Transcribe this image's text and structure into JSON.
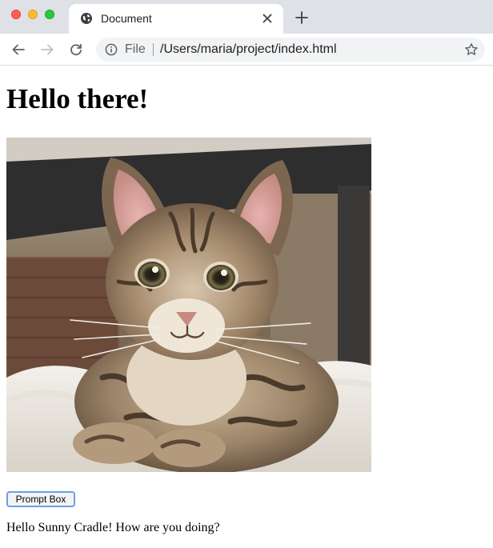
{
  "browser": {
    "tab": {
      "title": "Document"
    },
    "address": {
      "scheme": "File",
      "url": "/Users/maria/project/index.html"
    },
    "icons": {
      "tab_favicon": "globe-icon",
      "close": "close-icon",
      "new_tab": "plus-icon",
      "back": "arrow-left-icon",
      "forward": "arrow-right-icon",
      "reload": "reload-icon",
      "info": "info-icon",
      "bookmark": "star-icon"
    }
  },
  "page": {
    "heading": "Hello there!",
    "image": {
      "subject": "tabby kitten sitting on a fluffy white cat bed"
    },
    "button_label": "Prompt Box",
    "greeting": "Hello Sunny Cradle! How are you doing?"
  },
  "colors": {
    "tabbar_bg": "#dee1e6",
    "omnibox_bg": "#f1f3f4",
    "button_focus_ring": "#6c9fe6"
  }
}
